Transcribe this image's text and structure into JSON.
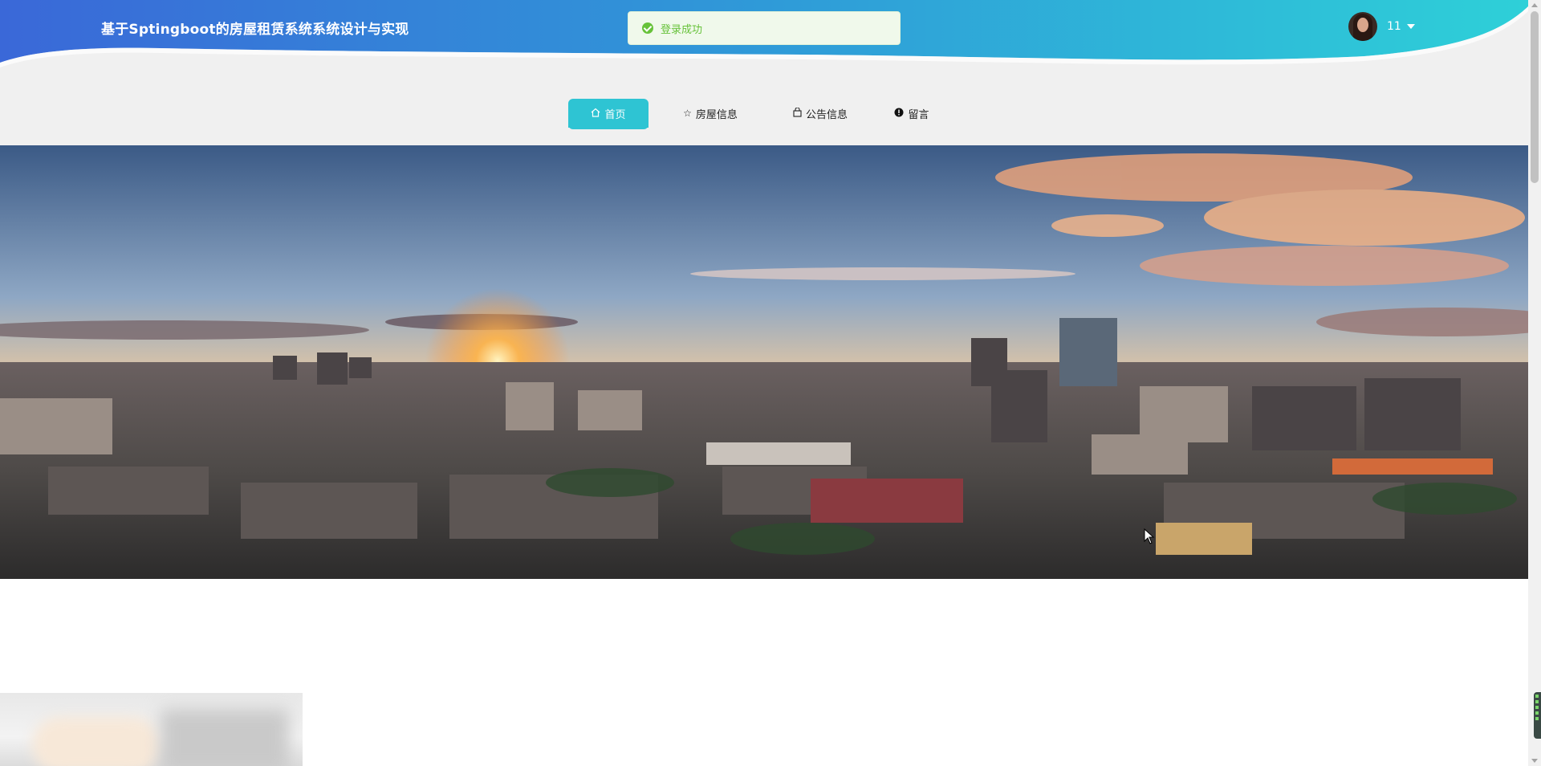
{
  "header": {
    "title": "基于Sptingboot的房屋租赁系统系统设计与实现",
    "gradient_start": "#3a68d8",
    "gradient_end": "#2ed0d8"
  },
  "toast": {
    "message": "登录成功",
    "icon": "check-circle-icon",
    "color": "#67c23a"
  },
  "user": {
    "name": "11",
    "avatar": "avatar-photo"
  },
  "nav": {
    "items": [
      {
        "label": "首页",
        "icon": "home-icon",
        "active": true
      },
      {
        "label": "房屋信息",
        "icon": "star-icon",
        "active": false
      },
      {
        "label": "公告信息",
        "icon": "bag-icon",
        "active": false
      },
      {
        "label": "留言",
        "icon": "exclamation-circle-icon",
        "active": false
      }
    ],
    "active_color": "#2ec4d3"
  },
  "banner": {
    "image": "city-skyline-sunset-photo"
  }
}
